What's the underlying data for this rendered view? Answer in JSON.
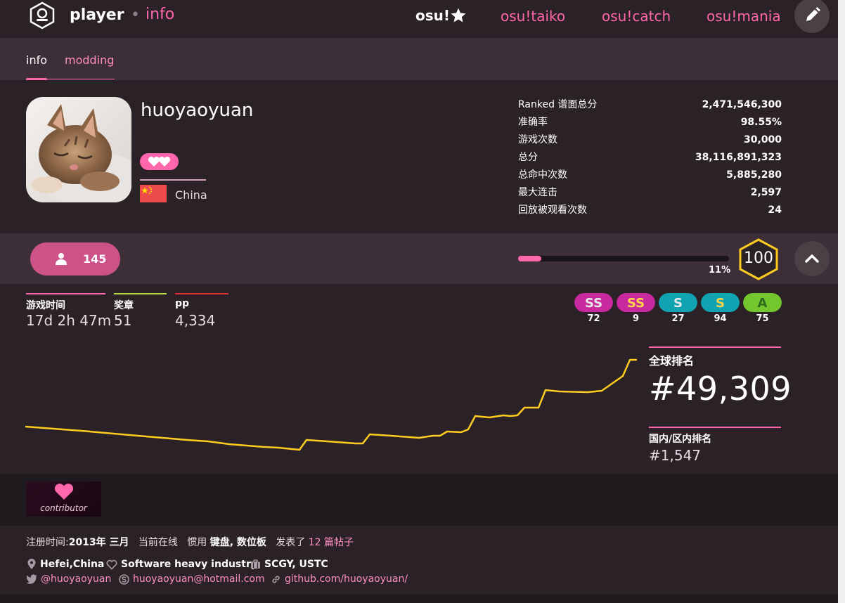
{
  "header": {
    "title_main": "player",
    "title_dot": "•",
    "title_sub": "info"
  },
  "modes": {
    "osu": "osu!",
    "taiko": "osu!taiko",
    "catch": "osu!catch",
    "mania": "osu!mania"
  },
  "tabs": {
    "info": "info",
    "modding": "modding"
  },
  "profile": {
    "username": "huoyaoyuan",
    "country": "China"
  },
  "stats": [
    {
      "label": "Ranked 谱面总分",
      "value": "2,471,546,300"
    },
    {
      "label": "准确率",
      "value": "98.55%"
    },
    {
      "label": "游戏次数",
      "value": "30,000"
    },
    {
      "label": "总分",
      "value": "38,116,891,323"
    },
    {
      "label": "总命中次数",
      "value": "5,885,280"
    },
    {
      "label": "最大连击",
      "value": "2,597"
    },
    {
      "label": "回放被观看次数",
      "value": "24"
    }
  ],
  "followers": "145",
  "level": {
    "progress_text": "11%",
    "progress": 0.11,
    "value": "100"
  },
  "mini_stats": [
    {
      "label": "游戏时间",
      "value": "17d 2h 47m",
      "color": "#ff66ab"
    },
    {
      "label": "奖章",
      "value": "51",
      "color": "#b3d944"
    },
    {
      "label": "pp",
      "value": "4,334",
      "color": "#d93030"
    }
  ],
  "grades": [
    {
      "label": "SS",
      "count": "72",
      "bg": "#c9299e",
      "fg": "#e8e8e8"
    },
    {
      "label": "SS",
      "count": "9",
      "bg": "#c9299e",
      "fg": "#ffd54a"
    },
    {
      "label": "S",
      "count": "27",
      "bg": "#12a3b3",
      "fg": "#e8e8e8"
    },
    {
      "label": "S",
      "count": "94",
      "bg": "#12a3b3",
      "fg": "#ffd54a"
    },
    {
      "label": "A",
      "count": "75",
      "bg": "#73c72c",
      "fg": "#2f6b1a"
    }
  ],
  "rank": {
    "global_label": "全球排名",
    "global_value": "#49,309",
    "country_label": "国内/区内排名",
    "country_value": "#1,547"
  },
  "badge": {
    "label": "contributor"
  },
  "footer": {
    "join_prefix": "注册时间:",
    "join_date": "2013年 三月",
    "online": "当前在线",
    "playstyle_prefix": "惯用",
    "playstyle": "键盘, 数位板",
    "posts_prefix": "发表了",
    "posts_link": "12 篇帖子",
    "location": "Hefei,China",
    "interests": "Software heavy industry",
    "occupation": "SCGY, USTC",
    "twitter": "@huoyaoyuan",
    "skype": "huoyaoyuan@hotmail.com",
    "website": "github.com/huoyaoyuan/"
  },
  "colors": {
    "accent": "#ff66ab",
    "chart_line": "#ffcc22",
    "level_ring": "#ffcc22"
  },
  "icons": {
    "logo": "osu-logo-icon",
    "mode_star": "star-icon",
    "edit": "pencil-icon",
    "follower": "user-icon",
    "collapse": "chevron-up-icon",
    "supporter": "heart-icon",
    "location": "map-marker-icon",
    "interests": "heart-outline-icon",
    "occupation": "suitcase-icon",
    "twitter": "twitter-icon",
    "skype": "skype-icon",
    "website": "link-icon"
  }
}
